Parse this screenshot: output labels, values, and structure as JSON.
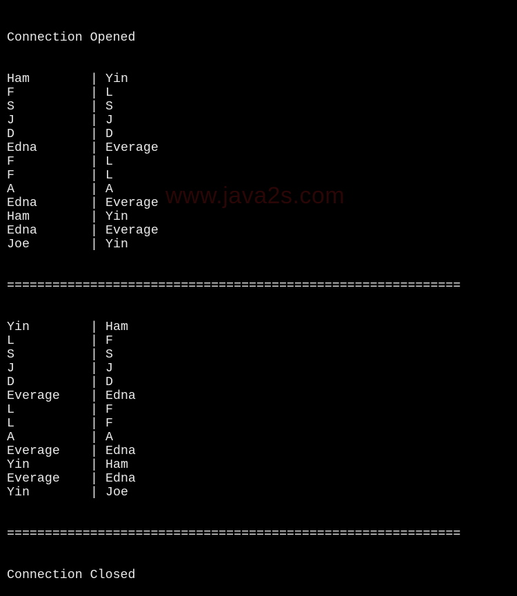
{
  "header": "Connection Opened",
  "footer": "Connection Closed",
  "divider": "============================================================",
  "separator": "|",
  "watermark": "www.java2s.com",
  "table1": [
    {
      "a": "Ham",
      "b": "Yin"
    },
    {
      "a": "F",
      "b": "L"
    },
    {
      "a": "S",
      "b": "S"
    },
    {
      "a": "J",
      "b": "J"
    },
    {
      "a": "D",
      "b": "D"
    },
    {
      "a": "Edna",
      "b": "Everage"
    },
    {
      "a": "F",
      "b": "L"
    },
    {
      "a": "F",
      "b": "L"
    },
    {
      "a": "A",
      "b": "A"
    },
    {
      "a": "Edna",
      "b": "Everage"
    },
    {
      "a": "Ham",
      "b": "Yin"
    },
    {
      "a": "Edna",
      "b": "Everage"
    },
    {
      "a": "Joe",
      "b": "Yin"
    }
  ],
  "table2": [
    {
      "a": "Yin",
      "b": "Ham"
    },
    {
      "a": "L",
      "b": "F"
    },
    {
      "a": "S",
      "b": "S"
    },
    {
      "a": "J",
      "b": "J"
    },
    {
      "a": "D",
      "b": "D"
    },
    {
      "a": "Everage",
      "b": "Edna"
    },
    {
      "a": "L",
      "b": "F"
    },
    {
      "a": "L",
      "b": "F"
    },
    {
      "a": "A",
      "b": "A"
    },
    {
      "a": "Everage",
      "b": "Edna"
    },
    {
      "a": "Yin",
      "b": "Ham"
    },
    {
      "a": "Everage",
      "b": "Edna"
    },
    {
      "a": "Yin",
      "b": "Joe"
    }
  ]
}
